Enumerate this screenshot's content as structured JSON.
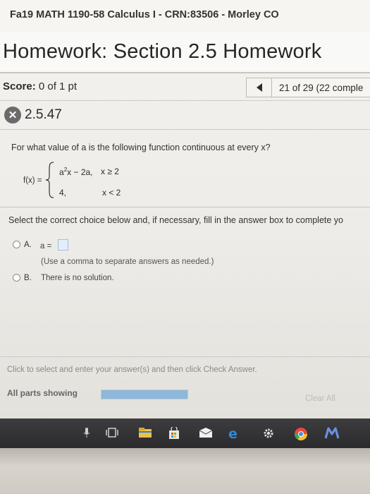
{
  "header": {
    "course_title": "Fa19 MATH 1190-58 Calculus I - CRN:83506 - Morley CO",
    "assignment_title": "Homework: Section 2.5 Homework"
  },
  "score": {
    "label": "Score:",
    "value": "0 of 1 pt"
  },
  "navigation": {
    "question_counter": "21 of 29 (22 comple"
  },
  "question": {
    "status_icon": "incorrect-x-icon",
    "number": "2.5.47",
    "prompt": "For what value of a is the following function continuous at every x?",
    "function_label": "f(x) =",
    "piece1_expr_a": "a",
    "piece1_exp": "2",
    "piece1_expr_rest": "x − 2a,",
    "piece1_cond": "x ≥ 2",
    "piece2_expr": "4,",
    "piece2_cond": "x < 2"
  },
  "instruction": "Select the correct choice below and, if necessary, fill in the answer box to complete yo",
  "options": {
    "a": {
      "letter": "A.",
      "text": "a =",
      "hint": "(Use a comma to separate answers as needed.)"
    },
    "b": {
      "letter": "B.",
      "text": "There is no solution."
    }
  },
  "footer": {
    "status_text": "Click to select and enter your answer(s) and then click Check Answer.",
    "parts_label": "All parts showing",
    "progress_fraction": 1.0,
    "clear_all": "Clear All"
  },
  "taskbar": {
    "icons": [
      "microphone-icon",
      "task-view-icon",
      "file-explorer-icon",
      "store-icon",
      "mail-icon",
      "edge-icon",
      "settings-icon",
      "chrome-icon",
      "app-m-icon"
    ]
  },
  "colors": {
    "taskbar": "#2f2e31",
    "progress": "#8fb7d8",
    "edge_blue": "#2e8ad8"
  }
}
